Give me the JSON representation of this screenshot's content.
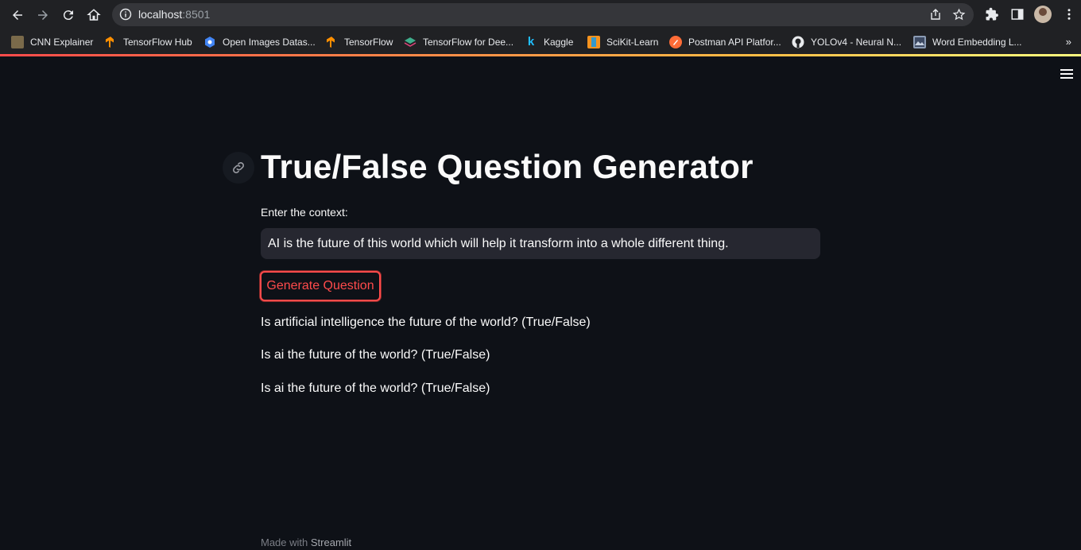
{
  "browser": {
    "url_host": "localhost",
    "url_port": ":8501",
    "bookmarks": [
      {
        "label": "CNN Explainer",
        "icon": "cnn-explainer-icon",
        "color": "#7a6a4a"
      },
      {
        "label": "TensorFlow Hub",
        "icon": "tensorflow-icon",
        "color": "#ff8f00"
      },
      {
        "label": "Open Images Datas...",
        "icon": "google-cloud-icon",
        "color": "#4285f4"
      },
      {
        "label": "TensorFlow",
        "icon": "tensorflow-icon",
        "color": "#ff8f00"
      },
      {
        "label": "TensorFlow for Dee...",
        "icon": "stack-icon",
        "color": "#3fae8c"
      },
      {
        "label": "Kaggle",
        "icon": "kaggle-icon",
        "color": "#20beff"
      },
      {
        "label": "SciKit-Learn",
        "icon": "scikit-icon",
        "color": "#f7931e"
      },
      {
        "label": "Postman API Platfor...",
        "icon": "postman-icon",
        "color": "#ff6c37"
      },
      {
        "label": "YOLOv4 - Neural N...",
        "icon": "github-icon",
        "color": "#e8eaed"
      },
      {
        "label": "Word Embedding L...",
        "icon": "image-icon",
        "color": "#8b9bb4"
      }
    ],
    "more_label": "»"
  },
  "app": {
    "title": "True/False Question Generator",
    "input_label": "Enter the context:",
    "input_value": "AI is the future of this world which will help it transform into a whole different thing.",
    "button_label": "Generate Question",
    "questions": [
      "Is artificial intelligence the future of the world? (True/False)",
      "Is ai the future of the world? (True/False)",
      "Is ai the future of the world? (True/False)"
    ],
    "footer_prefix": "Made with ",
    "footer_brand": "Streamlit",
    "colors": {
      "background": "#0e1117",
      "primary": "#ff4b4b",
      "input_bg": "#262730"
    }
  }
}
